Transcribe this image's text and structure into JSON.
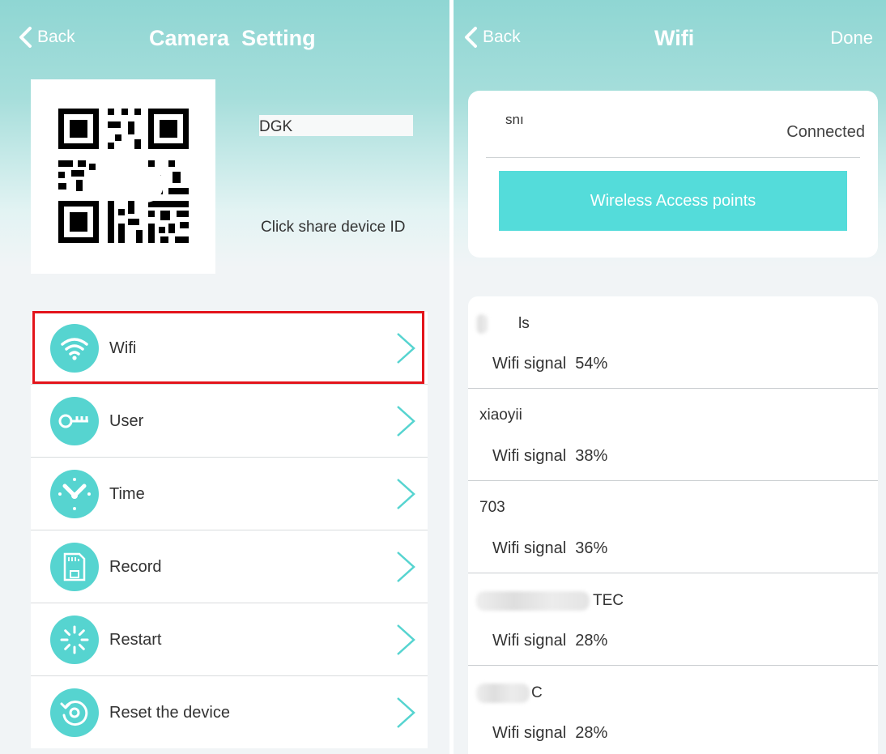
{
  "left": {
    "nav": {
      "back": "Back",
      "title": "Camera  Setting"
    },
    "device": {
      "name": "DGK",
      "share": "Click share device ID"
    },
    "menu": [
      {
        "label": "Wifi",
        "icon": "wifi-icon"
      },
      {
        "label": "User",
        "icon": "key-icon"
      },
      {
        "label": "Time",
        "icon": "clock-icon"
      },
      {
        "label": "Record",
        "icon": "sd-card-icon"
      },
      {
        "label": "Restart",
        "icon": "spinner-icon"
      },
      {
        "label": "Reset the device",
        "icon": "reset-icon"
      }
    ],
    "highlighted_item": "Wifi"
  },
  "right": {
    "nav": {
      "back": "Back",
      "title": "Wifi",
      "done": "Done"
    },
    "current": {
      "ssid": "snı",
      "status": "Connected"
    },
    "button": "Wireless Access points",
    "networks": [
      {
        "name": "ls",
        "signal": "Wifi signal  54%"
      },
      {
        "name": "xiaoyii",
        "signal": "Wifi signal  38%"
      },
      {
        "name": "703",
        "signal": "Wifi signal  36%"
      },
      {
        "name": "TEC",
        "signal": "Wifi signal  28%"
      },
      {
        "name": "C",
        "signal": "Wifi signal  28%"
      }
    ]
  },
  "colors": {
    "accent": "#56d4d0",
    "highlight": "#e3141b",
    "header": "#8fd6d3"
  }
}
